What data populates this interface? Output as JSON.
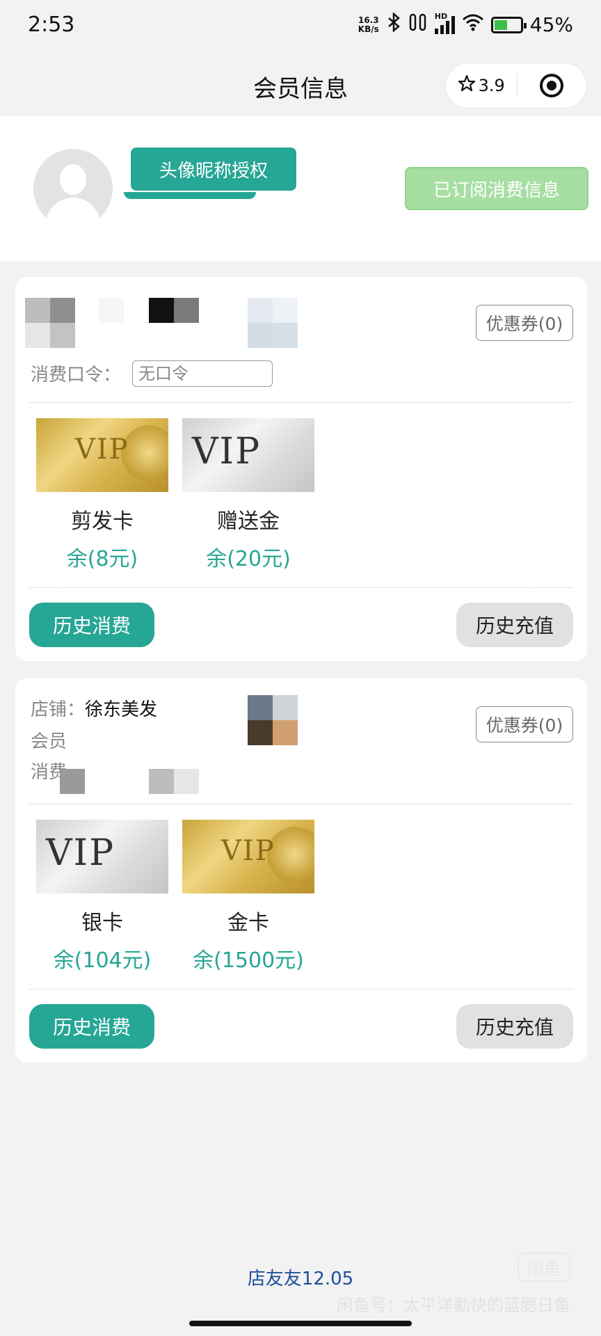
{
  "status_bar": {
    "time": "2:53",
    "net_speed_value": "16.3",
    "net_speed_unit": "KB/s",
    "hd_label": "HD",
    "battery": "45%"
  },
  "nav": {
    "title": "会员信息",
    "rating": "3.9"
  },
  "header": {
    "auth_button": "头像昵称授权",
    "subscribe_button": "已订阅消费信息"
  },
  "cards": [
    {
      "coupon": "优惠券(0)",
      "password_label": "消费口令：",
      "password_value": "无口令",
      "items": [
        {
          "name": "剪发卡",
          "balance": "余(8元)",
          "style": "gold"
        },
        {
          "name": "赠送金",
          "balance": "余(20元)",
          "style": "silver"
        }
      ],
      "history_consume": "历史消费",
      "history_recharge": "历史充值"
    },
    {
      "shop_label": "店铺：",
      "shop_name": "徐东美发",
      "member_label": "会员",
      "consume_label": "消费",
      "coupon": "优惠券(0)",
      "items": [
        {
          "name": "银卡",
          "balance": "余(104元)",
          "style": "silver"
        },
        {
          "name": "金卡",
          "balance": "余(1500元)",
          "style": "gold"
        }
      ],
      "history_consume": "历史消费",
      "history_recharge": "历史充值"
    }
  ],
  "footer": {
    "version": "店友友12.05",
    "watermark_logo": "闲鱼",
    "watermark_text": "闲鱼号：太平洋勤快的蓝腮日鱼"
  },
  "colors": {
    "accent": "#26a695",
    "subscribed": "#a7dea2",
    "footer_link": "#1e4f9a"
  }
}
